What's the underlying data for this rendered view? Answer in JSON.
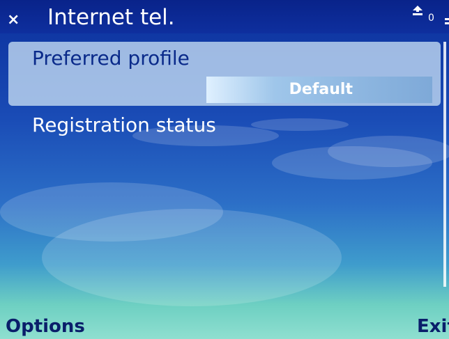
{
  "header": {
    "title": "Internet tel.",
    "close_glyph": "×",
    "indicator_number": "0",
    "icons": [
      "close-icon",
      "signal-icon",
      "battery-icon"
    ]
  },
  "list": {
    "items": [
      {
        "label": "Preferred profile",
        "value": "Default",
        "selected": true
      },
      {
        "label": "Registration status"
      }
    ]
  },
  "softkeys": {
    "left": "Options",
    "right": "Exit"
  },
  "colors": {
    "header_bg": "#0e2f9e",
    "selected_row_bg": "#bed7f0",
    "title_text": "#ffffff",
    "label_dark": "#0a2a8a",
    "softkey_text": "#0a1e6a"
  }
}
